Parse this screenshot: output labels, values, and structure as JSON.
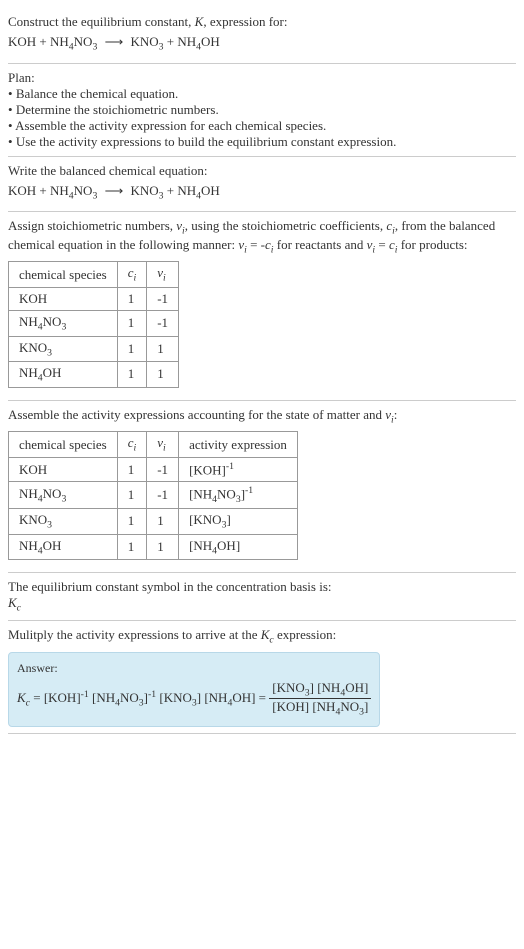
{
  "header": {
    "line1": "Construct the equilibrium constant, K, expression for:",
    "equation": "KOH + NH₄NO₃ ⟶ KNO₃ + NH₄OH"
  },
  "plan": {
    "title": "Plan:",
    "items": [
      "Balance the chemical equation.",
      "Determine the stoichiometric numbers.",
      "Assemble the activity expression for each chemical species.",
      "Use the activity expressions to build the equilibrium constant expression."
    ]
  },
  "balanced": {
    "title": "Write the balanced chemical equation:",
    "equation": "KOH + NH₄NO₃ ⟶ KNO₃ + NH₄OH"
  },
  "stoich": {
    "intro_a": "Assign stoichiometric numbers, νᵢ, using the stoichiometric coefficients, cᵢ, from the balanced chemical equation in the following manner: νᵢ = -cᵢ for reactants and νᵢ = cᵢ for products:",
    "headers": [
      "chemical species",
      "cᵢ",
      "νᵢ"
    ],
    "rows": [
      [
        "KOH",
        "1",
        "-1"
      ],
      [
        "NH₄NO₃",
        "1",
        "-1"
      ],
      [
        "KNO₃",
        "1",
        "1"
      ],
      [
        "NH₄OH",
        "1",
        "1"
      ]
    ]
  },
  "activity": {
    "intro": "Assemble the activity expressions accounting for the state of matter and νᵢ:",
    "headers": [
      "chemical species",
      "cᵢ",
      "νᵢ",
      "activity expression"
    ],
    "rows": [
      [
        "KOH",
        "1",
        "-1",
        "[KOH]⁻¹"
      ],
      [
        "NH₄NO₃",
        "1",
        "-1",
        "[NH₄NO₃]⁻¹"
      ],
      [
        "KNO₃",
        "1",
        "1",
        "[KNO₃]"
      ],
      [
        "NH₄OH",
        "1",
        "1",
        "[NH₄OH]"
      ]
    ]
  },
  "symbol": {
    "line1": "The equilibrium constant symbol in the concentration basis is:",
    "line2": "K_c"
  },
  "multiply": {
    "line": "Mulitply the activity expressions to arrive at the K_c expression:"
  },
  "answer": {
    "label": "Answer:",
    "lhs": "K_c = [KOH]⁻¹ [NH₄NO₃]⁻¹ [KNO₃] [NH₄OH] = ",
    "num": "[KNO₃] [NH₄OH]",
    "den": "[KOH] [NH₄NO₃]"
  }
}
